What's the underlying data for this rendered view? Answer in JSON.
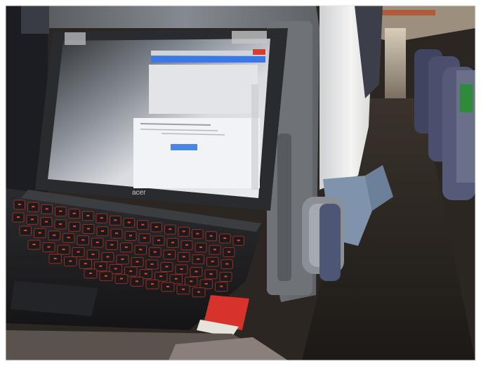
{
  "photo": {
    "subject": "laptop-on-train-seatback-tray",
    "laptop_brand": "acer",
    "screen": {
      "dialog_button_label": "",
      "browser_accent": "#3b78e7"
    },
    "colors": {
      "keyboard_backlight": "#ff3b1f",
      "seat_plastic": "#6f7378",
      "train_floor": "#231f1c",
      "seat_fabric": "#4b4f6e"
    }
  }
}
